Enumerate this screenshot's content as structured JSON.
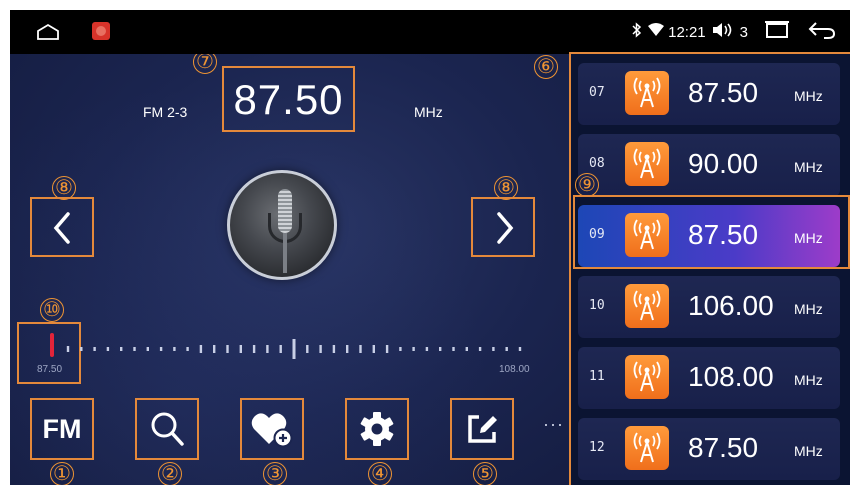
{
  "status_bar": {
    "time": "12:21",
    "volume": "3",
    "icons": [
      "home-icon",
      "app-icon",
      "bluetooth-icon",
      "wifi-icon",
      "volume-icon",
      "recent-apps-icon",
      "back-icon"
    ]
  },
  "tuner": {
    "band": "FM 2-3",
    "frequency": "87.50",
    "unit": "MHz",
    "dial_min": "87.50",
    "dial_max": "108.00",
    "ellipsis": "···"
  },
  "callouts": {
    "c1": "①",
    "c2": "②",
    "c3": "③",
    "c4": "④",
    "c5": "⑤",
    "c6": "⑥",
    "c7": "⑦",
    "c8a": "⑧",
    "c8b": "⑧",
    "c9": "⑨",
    "c10": "⑩"
  },
  "bottom_buttons": {
    "fm_label": "FM",
    "icons": [
      "band-icon",
      "search-icon",
      "favorite-add-icon",
      "settings-icon",
      "edit-icon"
    ]
  },
  "presets": [
    {
      "num": "07",
      "freq": "87.50",
      "unit": "MHz",
      "active": false
    },
    {
      "num": "08",
      "freq": "90.00",
      "unit": "MHz",
      "active": false
    },
    {
      "num": "09",
      "freq": "87.50",
      "unit": "MHz",
      "active": true
    },
    {
      "num": "10",
      "freq": "106.00",
      "unit": "MHz",
      "active": false
    },
    {
      "num": "11",
      "freq": "108.00",
      "unit": "MHz",
      "active": false
    },
    {
      "num": "12",
      "freq": "87.50",
      "unit": "MHz",
      "active": false
    }
  ],
  "colors": {
    "annotation": "#e4893b",
    "background": "#1b2550",
    "preset_active_start": "#1d47b6",
    "preset_active_end": "#9d3cc9",
    "needle": "#e3243a"
  }
}
